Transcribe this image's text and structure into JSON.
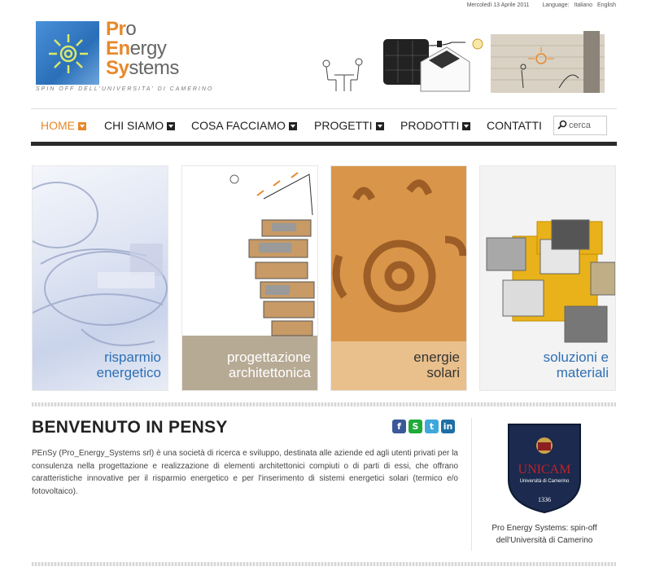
{
  "topbar": {
    "date": "Mercoledì 13 Aprile 2011",
    "language_label": "Language:",
    "languages": [
      "Italiano",
      "English"
    ]
  },
  "logo": {
    "line1_initial": "Pr",
    "line1_rest": "o",
    "line2_initial": "En",
    "line2_rest": "ergy",
    "line3_initial": "Sy",
    "line3_rest": "stems",
    "tagline": "SPIN OFF DELL'UNIVERSITA' DI CAMERINO"
  },
  "nav": {
    "items": [
      {
        "label": "HOME",
        "active": true
      },
      {
        "label": "CHI SIAMO"
      },
      {
        "label": "COSA FACCIAMO"
      },
      {
        "label": "PROGETTI"
      },
      {
        "label": "PRODOTTI"
      },
      {
        "label": "CONTATTI"
      }
    ],
    "search_placeholder": "cerca"
  },
  "tiles": [
    {
      "label": "risparmio\nenergetico"
    },
    {
      "label": "progettazione\narchitettonica"
    },
    {
      "label": "energie\nsolari"
    },
    {
      "label": "soluzioni e\nmateriali"
    }
  ],
  "welcome": {
    "title": "BENVENUTO IN PENSY",
    "body": "PEnSy (Pro_Energy_Systems srl) è una società di ricerca e sviluppo, destinata alle aziende ed agli utenti privati per la consulenza nella progettazione e realizzazione di elementi architettonici compiuti o di parti di essi, che offrano caratteristiche innovative per il risparmio energetico e per l'inserimento di sistemi energetici solari (termico e/o fotovoltaico)."
  },
  "social": [
    {
      "icon": "facebook-icon",
      "glyph": "f",
      "color": "#3b5998"
    },
    {
      "icon": "skype-icon",
      "glyph": "S",
      "color": "#1faa3a"
    },
    {
      "icon": "twitter-icon",
      "glyph": "t",
      "color": "#3ea8dc"
    },
    {
      "icon": "linkedin-icon",
      "glyph": "in",
      "color": "#1d6fa5"
    }
  ],
  "sidebar": {
    "seal_name": "UNICAM",
    "seal_sub": "Università di Camerino",
    "seal_year": "1336",
    "caption_line1": "Pro Energy Systems: spin-off",
    "caption_line2": "dell'Università di Camerino"
  }
}
